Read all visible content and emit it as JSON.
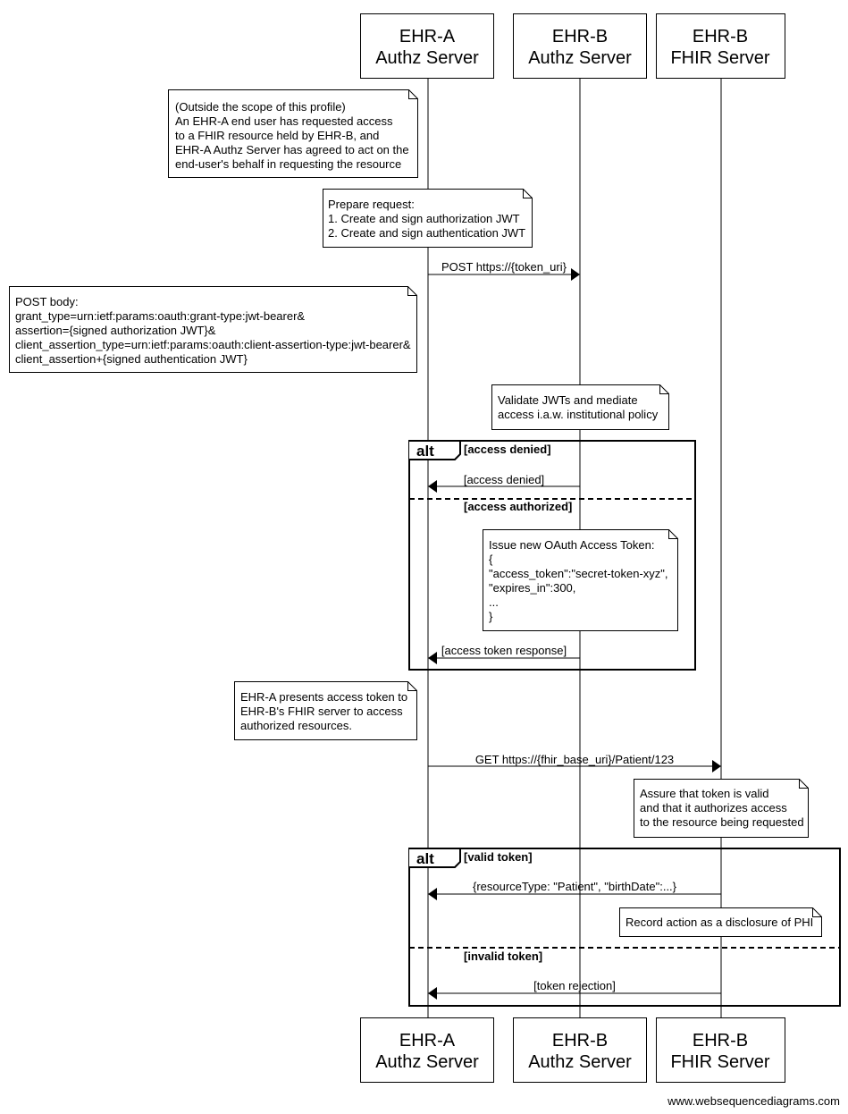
{
  "participants": [
    {
      "line1": "EHR-A",
      "line2": "Authz Server"
    },
    {
      "line1": "EHR-B",
      "line2": "Authz Server"
    },
    {
      "line1": "EHR-B",
      "line2": "FHIR Server"
    }
  ],
  "notes": {
    "scope": [
      "(Outside the scope of this profile)",
      "An EHR-A end user has requested access",
      "to a FHIR resource held by EHR-B, and",
      "EHR-A Authz Server has agreed to act on the",
      "end-user's behalf in requesting the resource"
    ],
    "prepare": [
      "Prepare request:",
      "1. Create and sign authorization JWT",
      "2. Create and sign authentication JWT"
    ],
    "post_body": [
      "POST body:",
      "grant_type=urn:ietf:params:oauth:grant-type:jwt-bearer&",
      "assertion={signed authorization JWT}&",
      "client_assertion_type=urn:ietf:params:oauth:client-assertion-type:jwt-bearer&",
      "client_assertion+{signed authentication JWT}"
    ],
    "validate": [
      "Validate JWTs and mediate",
      "access i.a.w. institutional policy"
    ],
    "issue": [
      "Issue new OAuth Access Token:",
      "{",
      "\"access_token\":\"secret-token-xyz\",",
      "\"expires_in\":300,",
      "...",
      "}"
    ],
    "present": [
      "EHR-A presents access token to",
      "EHR-B's FHIR server to access",
      "authorized resources."
    ],
    "assure": [
      "Assure that token is valid",
      "and that it authorizes access",
      "to the resource being requested"
    ],
    "record": [
      "Record action as a disclosure of PHI"
    ]
  },
  "messages": {
    "post": "POST https://{token_uri}",
    "denied": "[access denied]",
    "token_response": "[access token response]",
    "get": "GET https://{fhir_base_uri}/Patient/123",
    "resource": "{resourceType: \"Patient\", \"birthDate\":...}",
    "rejection": "[token rejection]"
  },
  "alt1": {
    "label": "alt",
    "cond1": "[access denied]",
    "cond2": "[access authorized]"
  },
  "alt2": {
    "label": "alt",
    "cond1": "[valid token]",
    "cond2": "[invalid token]"
  },
  "footer": "www.websequencediagrams.com"
}
